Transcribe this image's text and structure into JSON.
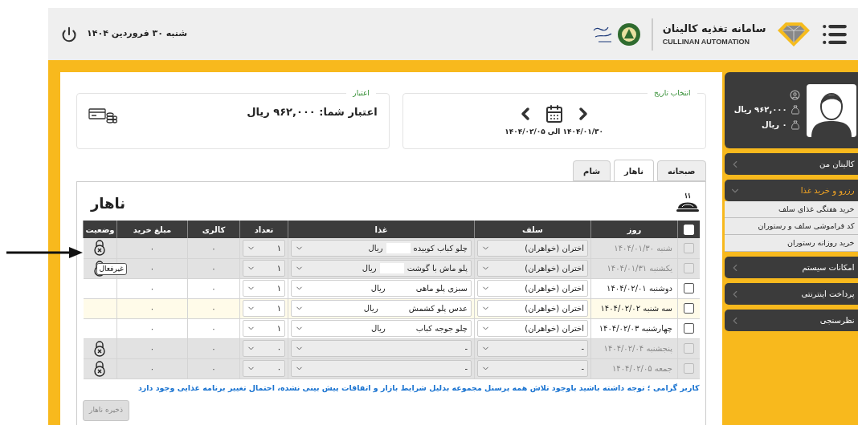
{
  "header": {
    "date": "شنبه ۳۰ فروردین ۱۴۰۴",
    "title": "سامانه تغذیه کالینان",
    "subtitle": "CULLINAN AUTOMATION"
  },
  "sidebar": {
    "balances": [
      "۹۶۲,۰۰۰ ریال",
      "۰ ریال"
    ],
    "menu": [
      {
        "label": "کالینان من",
        "expanded": false
      },
      {
        "label": "رزرو و خرید غذا",
        "expanded": true,
        "children": [
          {
            "label": "خرید هفتگی غذای سلف"
          },
          {
            "label": "کد فراموشی سلف و رستوران"
          },
          {
            "label": "خرید روزانه رستوران"
          }
        ]
      },
      {
        "label": "امکانات سیستم",
        "expanded": false
      },
      {
        "label": "پرداخت اینترنتی",
        "expanded": false
      },
      {
        "label": "نظرسنجی",
        "expanded": false
      }
    ]
  },
  "date_picker": {
    "legend": "انتخاب تاریخ",
    "range": "۱۴۰۴/۰۱/۳۰ الی ۱۴۰۴/۰۲/۰۵"
  },
  "credit": {
    "legend": "اعتبار",
    "text": "اعتبار شما: ۹۶۲,۰۰۰ ریال"
  },
  "tabs": [
    {
      "label": "صبحانه",
      "selected": false
    },
    {
      "label": "ناهار",
      "selected": true
    },
    {
      "label": "شام",
      "selected": false
    }
  ],
  "panel": {
    "title": "ناهار",
    "header_checked": false,
    "columns": [
      "روز",
      "سلف",
      "غذا",
      "تعداد",
      "کالری",
      "مبلغ خرید",
      "وضعیت"
    ],
    "rows": [
      {
        "day": "شنبه ۱۴۰۴/۰۱/۳۰",
        "self": "اختران (خواهران)",
        "food": "چلو کباب کوبیده",
        "price": "ریال",
        "count": "۱",
        "calorie": "۰",
        "amount": "۰",
        "disabled": true,
        "highlighted": false,
        "checked": false,
        "locked": true
      },
      {
        "day": "یکشنبه ۱۴۰۴/۰۱/۳۱",
        "self": "اختران (خواهران)",
        "food": "پلو ماش با گوشت",
        "price": "ریال",
        "count": "۱",
        "calorie": "۰",
        "amount": "۰",
        "disabled": true,
        "highlighted": false,
        "checked": false,
        "locked": true,
        "tooltip": "غیرفعال"
      },
      {
        "day": "دوشنبه ۱۴۰۴/۰۲/۰۱",
        "self": "اختران (خواهران)",
        "food": "سبزی پلو ماهی",
        "price": "ریال",
        "count": "۱",
        "calorie": "۰",
        "amount": "۰",
        "disabled": false,
        "highlighted": false,
        "checked": false,
        "locked": false
      },
      {
        "day": "سه شنبه ۱۴۰۴/۰۲/۰۲",
        "self": "اختران (خواهران)",
        "food": "عدس پلو کشمش",
        "price": "ریال",
        "count": "۱",
        "calorie": "۰",
        "amount": "۰",
        "disabled": false,
        "highlighted": true,
        "checked": false,
        "locked": false
      },
      {
        "day": "چهارشنبه ۱۴۰۴/۰۲/۰۳",
        "self": "اختران (خواهران)",
        "food": "چلو جوجه کباب",
        "price": "ریال",
        "count": "۱",
        "calorie": "۰",
        "amount": "۰",
        "disabled": false,
        "highlighted": false,
        "checked": false,
        "locked": false
      },
      {
        "day": "پنجشنبه ۱۴۰۴/۰۲/۰۴",
        "self": "-",
        "food": "-",
        "count": "۰",
        "calorie": "۰",
        "amount": "۰",
        "disabled": true,
        "highlighted": false,
        "checked": false,
        "locked": true
      },
      {
        "day": "جمعه ۱۴۰۴/۰۲/۰۵",
        "self": "-",
        "food": "-",
        "count": "۰",
        "calorie": "۰",
        "amount": "۰",
        "disabled": true,
        "highlighted": false,
        "checked": false,
        "locked": true
      }
    ],
    "note": "کاربر گرامی ؛ توجه داشته باشید باوجود تلاش همه پرسنل مجموعه بدلیل شرایط بازار و اتفاقات پیش بینی نشده، احتمال تغییر برنامه غذایی وجود دارد",
    "save_button": {
      "label": "ذخیره ناهار",
      "disabled": true
    }
  }
}
